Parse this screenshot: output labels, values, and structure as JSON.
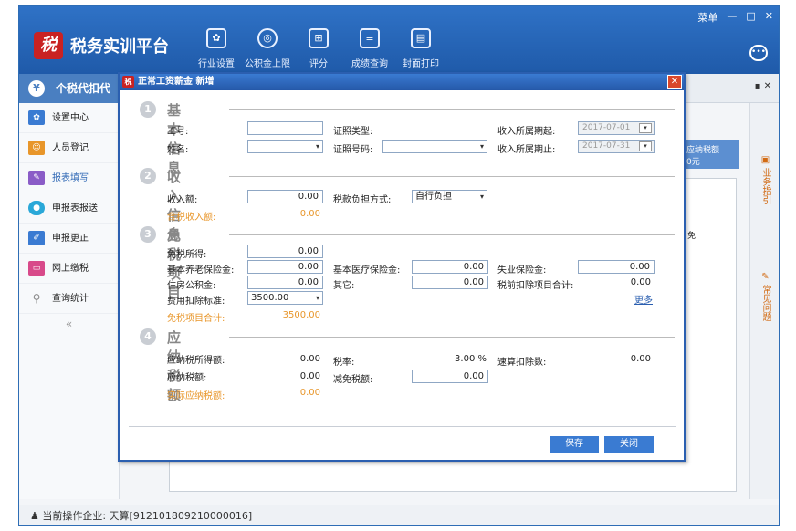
{
  "app": {
    "title": "税务实训平台",
    "logo_text": "税",
    "window_controls": {
      "menu": "菜单",
      "minimize": "—",
      "restore": "□",
      "close": "✕"
    },
    "top_nav": [
      {
        "label": "行业设置",
        "icon": "gear-icon"
      },
      {
        "label": "公积金上限",
        "icon": "coin-icon"
      },
      {
        "label": "评分",
        "icon": "grid-icon"
      },
      {
        "label": "成绩查询",
        "icon": "list-icon"
      },
      {
        "label": "封面打印",
        "icon": "print-icon"
      }
    ],
    "module_tab": "个税代扣代",
    "module_close": "✕"
  },
  "sidebar": {
    "items": [
      {
        "label": "设置中心",
        "icon": "settings-icon",
        "color": "#3a7bd2"
      },
      {
        "label": "人员登记",
        "icon": "person-icon",
        "color": "#e8962a"
      },
      {
        "label": "报表填写",
        "icon": "form-icon",
        "color": "#8a5cc7"
      },
      {
        "label": "申报表报送",
        "icon": "upload-icon",
        "color": "#2aa8d8"
      },
      {
        "label": "申报更正",
        "icon": "edit-icon",
        "color": "#3a7bd2"
      },
      {
        "label": "网上缴税",
        "icon": "pay-icon",
        "color": "#d84a8a"
      },
      {
        "label": "查询统计",
        "icon": "search-icon",
        "color": "#888888"
      }
    ],
    "collapse": "«"
  },
  "background_panel": {
    "tax_label": "应纳税额",
    "tax_value": "0元",
    "col": "免"
  },
  "right_rail": [
    {
      "label": "业务指引"
    },
    {
      "label": "常见问题"
    }
  ],
  "status": {
    "company": "当前操作企业: 天算[912101809210000016]"
  },
  "dialog": {
    "title": "正常工资薪金 新增",
    "close": "✕",
    "sections": {
      "basic": {
        "num": "1",
        "title": "基本信息"
      },
      "income": {
        "num": "2",
        "title": "收入信息"
      },
      "exempt": {
        "num": "3",
        "title": "免税项目"
      },
      "tax": {
        "num": "4",
        "title": "应纳税额"
      }
    },
    "basic": {
      "emp_no_label": "工号:",
      "emp_no": "",
      "name_label": "姓名:",
      "name": "",
      "id_type_label": "证照类型:",
      "id_no_label": "证照号码:",
      "period_start_label": "收入所属期起:",
      "period_start": "2017-07-01",
      "period_end_label": "收入所属期止:",
      "period_end": "2017-07-31"
    },
    "income": {
      "income_label": "收入额:",
      "income": "0.00",
      "burden_label": "税款负担方式:",
      "burden": "自行负担",
      "taxable_income_label": "含税收入额:",
      "taxable_income": "0.00"
    },
    "exempt": {
      "exempt_income_label": "免税所得:",
      "exempt_income": "0.00",
      "pension_label": "基本养老保险金:",
      "pension": "0.00",
      "medical_label": "基本医疗保险金:",
      "medical": "0.00",
      "unemployment_label": "失业保险金:",
      "unemployment": "0.00",
      "housing_label": "住房公积金:",
      "housing": "0.00",
      "other_label": "其它:",
      "other": "0.00",
      "pretax_total_label": "税前扣除项目合计:",
      "pretax_total": "0.00",
      "deduction_label": "费用扣除标准:",
      "deduction": "3500.00",
      "more": "更多",
      "exempt_total_label": "免税项目合计:",
      "exempt_total": "3500.00"
    },
    "tax": {
      "taxable_label": "应纳税所得额:",
      "taxable": "0.00",
      "rate_label": "税率:",
      "rate": "3.00 %",
      "quick_label": "速算扣除数:",
      "quick": "0.00",
      "payable_label": "应纳税额:",
      "payable": "0.00",
      "reduction_label": "减免税额:",
      "reduction": "0.00",
      "actual_label": "实际应纳税额:",
      "actual": "0.00"
    },
    "buttons": {
      "save": "保存",
      "close": "关闭"
    }
  }
}
